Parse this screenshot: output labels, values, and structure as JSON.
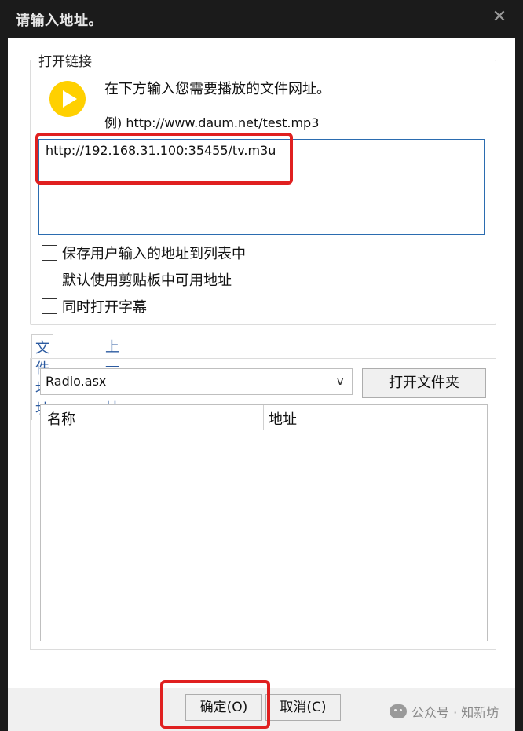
{
  "window": {
    "title": "请输入地址。",
    "close_glyph": "✕"
  },
  "open_link": {
    "group_label": "打开链接",
    "instruction": "在下方输入您需要播放的文件网址。",
    "example": "例) http://www.daum.net/test.mp3",
    "url_value": "http://192.168.31.100:35455/tv.m3u"
  },
  "options": [
    {
      "label": "保存用户输入的地址到列表中",
      "checked": false
    },
    {
      "label": "默认使用剪贴板中可用地址",
      "checked": false
    },
    {
      "label": "同时打开字幕",
      "checked": false
    }
  ],
  "tabs": [
    {
      "label": "文件地址",
      "active": true
    },
    {
      "label": "上一地址",
      "active": false
    }
  ],
  "file_panel": {
    "combo_value": "Radio.asx",
    "combo_arrow": "v",
    "open_folder_label": "打开文件夹",
    "columns": [
      "名称",
      "地址"
    ]
  },
  "footer": {
    "ok_label": "确定(O)",
    "cancel_label": "取消(C)",
    "watermark": "公众号 · 知新坊"
  },
  "colors": {
    "accent_link": "#2b5aa0",
    "highlight_red": "#e02020",
    "play_yellow": "#ffd000"
  }
}
